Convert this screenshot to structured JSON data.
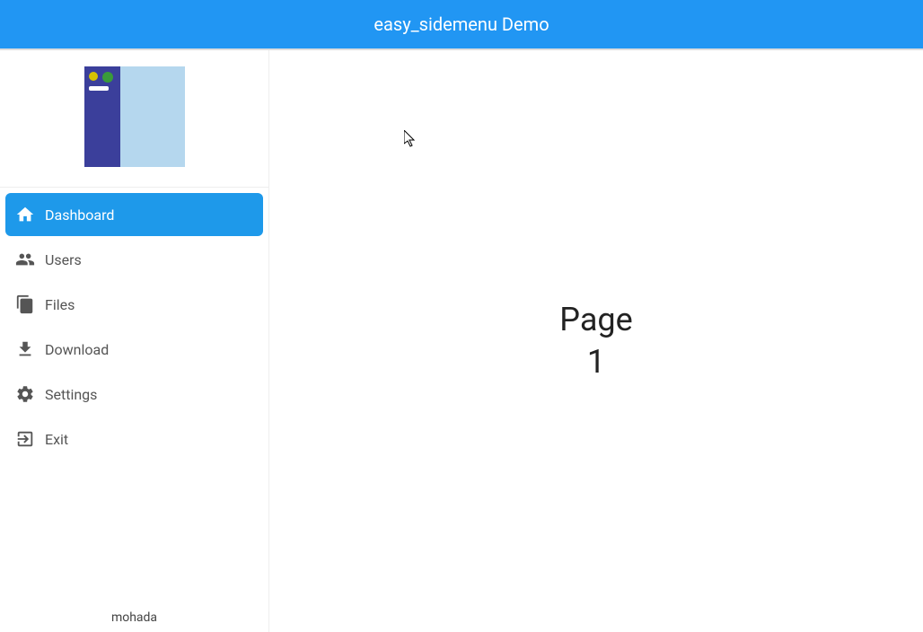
{
  "header": {
    "title": "easy_sidemenu Demo"
  },
  "sidebar": {
    "items": [
      {
        "label": "Dashboard",
        "icon": "home-icon",
        "selected": true
      },
      {
        "label": "Users",
        "icon": "users-icon",
        "selected": false
      },
      {
        "label": "Files",
        "icon": "files-icon",
        "selected": false
      },
      {
        "label": "Download",
        "icon": "download-icon",
        "selected": false
      },
      {
        "label": "Settings",
        "icon": "settings-icon",
        "selected": false
      },
      {
        "label": "Exit",
        "icon": "exit-icon",
        "selected": false
      }
    ],
    "footer": "mohada"
  },
  "main": {
    "content": "Page\n1"
  }
}
